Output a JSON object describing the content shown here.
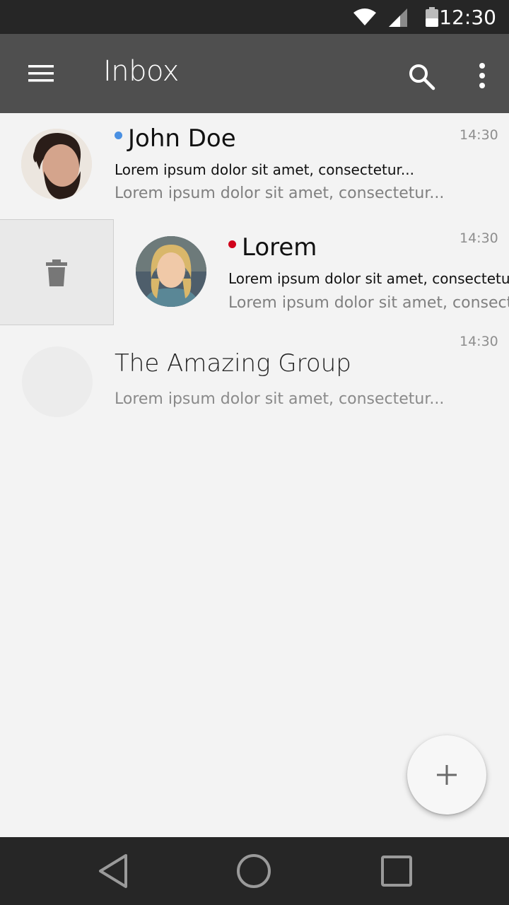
{
  "status_bar": {
    "time": "12:30",
    "icons": [
      "wifi-icon",
      "signal-icon",
      "battery-icon"
    ]
  },
  "app_bar": {
    "title": "Inbox",
    "icons": [
      "menu-icon",
      "search-icon",
      "more-vert-icon"
    ]
  },
  "messages": [
    {
      "sender": "John Doe",
      "subject": "Lorem ipsum dolor sit amet, consectetur...",
      "preview": "Lorem ipsum dolor sit amet, consectetur...",
      "time": "14:30",
      "unread": true,
      "dot_color": "#4a90e2"
    },
    {
      "sender": "Lorem",
      "subject": "Lorem ipsum dolor sit amet, consectetur...",
      "preview": "Lorem ipsum dolor sit amet, consectetur...",
      "time": "14:30",
      "unread": true,
      "dot_color": "#d0021b",
      "swiped": true
    },
    {
      "sender": "The Amazing Group",
      "preview": "Lorem ipsum dolor sit amet, consectetur...",
      "time": "14:30",
      "unread": false
    }
  ],
  "actions": {
    "delete_icon": "trash-icon",
    "compose_icon": "plus-icon"
  },
  "nav_bar": {
    "icons": [
      "back-icon",
      "home-icon",
      "recents-icon"
    ]
  },
  "colors": {
    "status_bar": "#262626",
    "app_bar": "#4f4f4f",
    "background": "#f3f3f3",
    "unread_blue": "#4a90e2",
    "unread_red": "#d0021b"
  }
}
